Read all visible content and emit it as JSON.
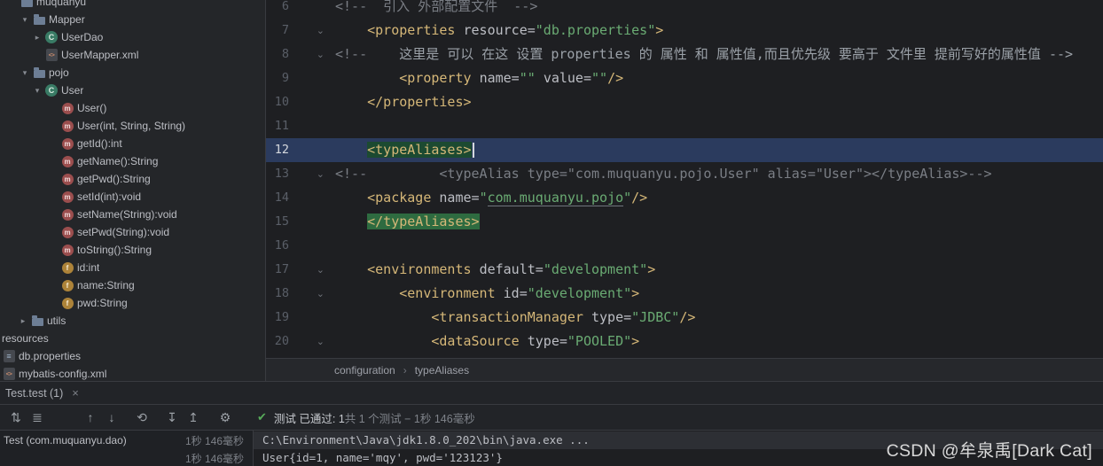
{
  "colors": {
    "editor_bg": "#1e1f22",
    "tag": "#d5b778",
    "string": "#6aab73",
    "comment": "#7a7e85",
    "line_highlight": "#2b3b5e",
    "matched_tag_highlight": "#2e6b40",
    "passed_green": "#57ab5a"
  },
  "tree": {
    "items": [
      {
        "label": "muquanyu",
        "icon": "folder",
        "chevron": "none",
        "pad": 22
      },
      {
        "label": "Mapper",
        "icon": "folder",
        "chevron": "down",
        "pad": 20
      },
      {
        "label": "UserDao",
        "icon": "class",
        "chevron": "right",
        "pad": 34
      },
      {
        "label": "UserMapper.xml",
        "icon": "xml",
        "chevron": "none",
        "pad": 50
      },
      {
        "label": "pojo",
        "icon": "folder",
        "chevron": "down",
        "pad": 20
      },
      {
        "label": "User",
        "icon": "class",
        "chevron": "down",
        "pad": 34
      },
      {
        "label": "User()",
        "icon": "method",
        "chevron": "none",
        "pad": 68
      },
      {
        "label": "User(int, String, String)",
        "icon": "method",
        "chevron": "none",
        "pad": 68
      },
      {
        "label": "getId():int",
        "icon": "method",
        "chevron": "none",
        "pad": 68
      },
      {
        "label": "getName():String",
        "icon": "method",
        "chevron": "none",
        "pad": 68
      },
      {
        "label": "getPwd():String",
        "icon": "method",
        "chevron": "none",
        "pad": 68
      },
      {
        "label": "setId(int):void",
        "icon": "method",
        "chevron": "none",
        "pad": 68
      },
      {
        "label": "setName(String):void",
        "icon": "method",
        "chevron": "none",
        "pad": 68
      },
      {
        "label": "setPwd(String):void",
        "icon": "method",
        "chevron": "none",
        "pad": 68
      },
      {
        "label": "toString():String",
        "icon": "method",
        "chevron": "none",
        "pad": 68
      },
      {
        "label": "id:int",
        "icon": "field",
        "chevron": "none",
        "pad": 68
      },
      {
        "label": "name:String",
        "icon": "field",
        "chevron": "none",
        "pad": 68
      },
      {
        "label": "pwd:String",
        "icon": "field",
        "chevron": "none",
        "pad": 68
      },
      {
        "label": "utils",
        "icon": "folder",
        "chevron": "right",
        "pad": 18
      },
      {
        "label": "resources",
        "icon": "none",
        "chevron": "none",
        "pad": 2
      },
      {
        "label": "db.properties",
        "icon": "props",
        "chevron": "none",
        "pad": 2
      },
      {
        "label": "mybatis-config.xml",
        "icon": "xml",
        "chevron": "none",
        "pad": 2
      }
    ]
  },
  "editor": {
    "lines": [
      {
        "num": 6,
        "tokens": [
          {
            "t": "cmt",
            "s": "<!--  引入 外部配置文件  -->"
          }
        ]
      },
      {
        "num": 7,
        "fold": true,
        "tokens": [
          {
            "t": "pln",
            "s": "    "
          },
          {
            "t": "tag",
            "s": "<properties"
          },
          {
            "t": "pln",
            "s": " "
          },
          {
            "t": "attr",
            "s": "resource="
          },
          {
            "t": "str",
            "s": "\"db.properties\""
          },
          {
            "t": "tag",
            "s": ">"
          }
        ]
      },
      {
        "num": 8,
        "fold": true,
        "tokens": [
          {
            "t": "cmt",
            "s": "<!--    "
          },
          {
            "t": "cmt2",
            "s": "这里是 可以 在这 设置 properties 的 属性 和 属性值,而且优先级 要高于 文件里 提前写好的属性值 -->"
          }
        ]
      },
      {
        "num": 9,
        "tokens": [
          {
            "t": "pln",
            "s": "        "
          },
          {
            "t": "tag",
            "s": "<property"
          },
          {
            "t": "pln",
            "s": " "
          },
          {
            "t": "attr",
            "s": "name="
          },
          {
            "t": "str",
            "s": "\"\""
          },
          {
            "t": "pln",
            "s": " "
          },
          {
            "t": "attr",
            "s": "value="
          },
          {
            "t": "str",
            "s": "\"\""
          },
          {
            "t": "tag",
            "s": "/>"
          }
        ]
      },
      {
        "num": 10,
        "tokens": [
          {
            "t": "pln",
            "s": "    "
          },
          {
            "t": "tag",
            "s": "</properties>"
          }
        ]
      },
      {
        "num": 11,
        "tokens": []
      },
      {
        "num": 12,
        "hl": true,
        "caret": true,
        "tokens": [
          {
            "t": "pln",
            "s": "    "
          },
          {
            "t": "taghl",
            "s": "<typeAliases>"
          }
        ]
      },
      {
        "num": 13,
        "fold": true,
        "tokens": [
          {
            "t": "cmt",
            "s": "<!--         <typeAlias type=\"com.muquanyu.pojo.User\" alias=\"User\"></typeAlias>-->"
          }
        ]
      },
      {
        "num": 14,
        "tokens": [
          {
            "t": "pln",
            "s": "    "
          },
          {
            "t": "tag",
            "s": "<package"
          },
          {
            "t": "pln",
            "s": " "
          },
          {
            "t": "attr",
            "s": "name="
          },
          {
            "t": "str",
            "s": "\""
          },
          {
            "t": "pkg",
            "s": "com.muquanyu.pojo"
          },
          {
            "t": "str",
            "s": "\""
          },
          {
            "t": "tag",
            "s": "/>"
          }
        ]
      },
      {
        "num": 15,
        "tokens": [
          {
            "t": "pln",
            "s": "    "
          },
          {
            "t": "taghl2",
            "s": "</typeAliases>"
          }
        ]
      },
      {
        "num": 16,
        "tokens": []
      },
      {
        "num": 17,
        "fold": true,
        "tokens": [
          {
            "t": "pln",
            "s": "    "
          },
          {
            "t": "tag",
            "s": "<environments"
          },
          {
            "t": "pln",
            "s": " "
          },
          {
            "t": "attr",
            "s": "default="
          },
          {
            "t": "str",
            "s": "\"development\""
          },
          {
            "t": "tag",
            "s": ">"
          }
        ]
      },
      {
        "num": 18,
        "fold": true,
        "tokens": [
          {
            "t": "pln",
            "s": "        "
          },
          {
            "t": "tag",
            "s": "<environment"
          },
          {
            "t": "pln",
            "s": " "
          },
          {
            "t": "attr",
            "s": "id="
          },
          {
            "t": "str",
            "s": "\"development\""
          },
          {
            "t": "tag",
            "s": ">"
          }
        ]
      },
      {
        "num": 19,
        "tokens": [
          {
            "t": "pln",
            "s": "            "
          },
          {
            "t": "tag",
            "s": "<transactionManager"
          },
          {
            "t": "pln",
            "s": " "
          },
          {
            "t": "attr",
            "s": "type="
          },
          {
            "t": "str",
            "s": "\"JDBC\""
          },
          {
            "t": "tag",
            "s": "/>"
          }
        ]
      },
      {
        "num": 20,
        "fold": true,
        "tokens": [
          {
            "t": "pln",
            "s": "            "
          },
          {
            "t": "tag",
            "s": "<dataSource"
          },
          {
            "t": "pln",
            "s": " "
          },
          {
            "t": "attr",
            "s": "type="
          },
          {
            "t": "str",
            "s": "\"POOLED\""
          },
          {
            "t": "tag",
            "s": ">"
          }
        ]
      }
    ]
  },
  "breadcrumbs": {
    "items": [
      "configuration",
      "typeAliases"
    ],
    "separator": "›"
  },
  "run_tab": {
    "label": "Test.test (1)",
    "close": "×"
  },
  "toolbar": {
    "icons": [
      {
        "name": "sort-icon",
        "glyph": "⇅"
      },
      {
        "name": "list-options-icon",
        "glyph": "≣"
      },
      {
        "name": "previous-test-icon",
        "glyph": "↑",
        "gap": 36
      },
      {
        "name": "next-test-icon",
        "glyph": "↓"
      },
      {
        "name": "test-history-icon",
        "glyph": "⟲",
        "gap": 10
      },
      {
        "name": "import-results-icon",
        "glyph": "↧",
        "gap": 10
      },
      {
        "name": "export-results-icon",
        "glyph": "↥"
      },
      {
        "name": "settings-gear-icon",
        "glyph": "⚙",
        "gap": 12
      }
    ]
  },
  "summary": {
    "check": "✔",
    "passed": "测试 已通过: 1",
    "detail": "共 1 个测试 − 1秒 146毫秒"
  },
  "test_panel": {
    "rows": [
      {
        "label": "Test (com.muquanyu.dao)",
        "time": "1秒 146毫秒"
      },
      {
        "label": "",
        "time": "1秒 146毫秒"
      }
    ]
  },
  "console_out": {
    "lines": [
      {
        "text": "C:\\Environment\\Java\\jdk1.8.0_202\\bin\\java.exe ...",
        "hl": true
      },
      {
        "text": "User{id=1, name='mqy', pwd='123123'}",
        "hl": false
      }
    ]
  },
  "watermark": {
    "text": "CSDN @牟泉禹[Dark Cat]"
  }
}
